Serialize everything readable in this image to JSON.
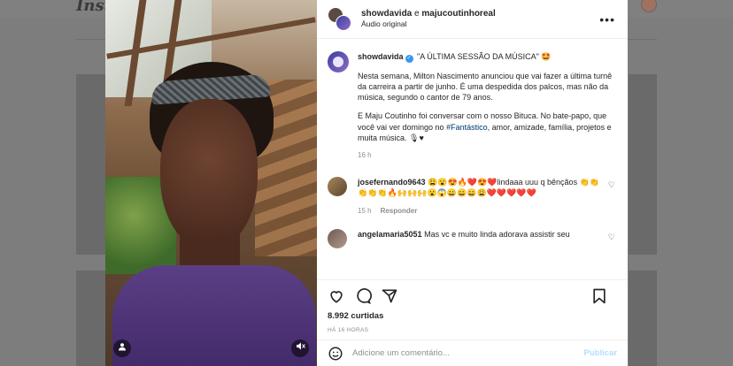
{
  "background": {
    "logo": "Insta"
  },
  "header": {
    "user1": "showdavida",
    "separator": " e ",
    "user2": "majucoutinhoreal",
    "audio": "Áudio original"
  },
  "caption": {
    "username": "showdavida",
    "headline": "\"A ÚLTIMA SESSÃO DA MÚSICA\" 🤩",
    "paragraph1": "Nesta semana, Milton Nascimento anunciou que vai fazer a última turnê da carreira a partir de junho. É uma despedida dos palcos, mas não da música, segundo o cantor de 79 anos.",
    "paragraph2_before": "E Maju Coutinho foi conversar com o nosso Bituca. No bate-papo, que você vai ver domingo no ",
    "hashtag": "#Fantástico",
    "paragraph2_after": ", amor, amizade, família, projetos e muita música. 🎙♥",
    "time": "16 h"
  },
  "comments": [
    {
      "username": "josefernando9643",
      "text": "😩😮😍🔥❤️😍❤️lindaaa uuu q bênçãos 👏👏👏👏👏🔥🙌🙌🙌😮😱😀😀😀😩❤️❤️❤️❤️❤️",
      "time": "15 h",
      "reply": "Responder"
    },
    {
      "username": "angelamaria5051",
      "text": "Mas vc e muito linda adorava assistir seu",
      "time": "",
      "reply": ""
    }
  ],
  "stats": {
    "likes": "8.992 curtidas",
    "time_ago": "HÁ 16 HORAS"
  },
  "comment_box": {
    "placeholder": "Adicione um comentário...",
    "publish": "Publicar"
  },
  "icons": {
    "more": "more-horizontal-icon",
    "verified": "verified-badge-icon",
    "like": "heart-outline-icon",
    "comment": "comment-bubble-icon",
    "share": "paper-plane-icon",
    "save": "bookmark-icon",
    "emoji": "smile-icon",
    "mute": "speaker-mute-icon",
    "user": "person-icon"
  },
  "colors": {
    "link": "#00376b",
    "verified": "#3897f0",
    "publish_disabled": "#b2dffc",
    "muted_text": "#8e8e8e"
  }
}
